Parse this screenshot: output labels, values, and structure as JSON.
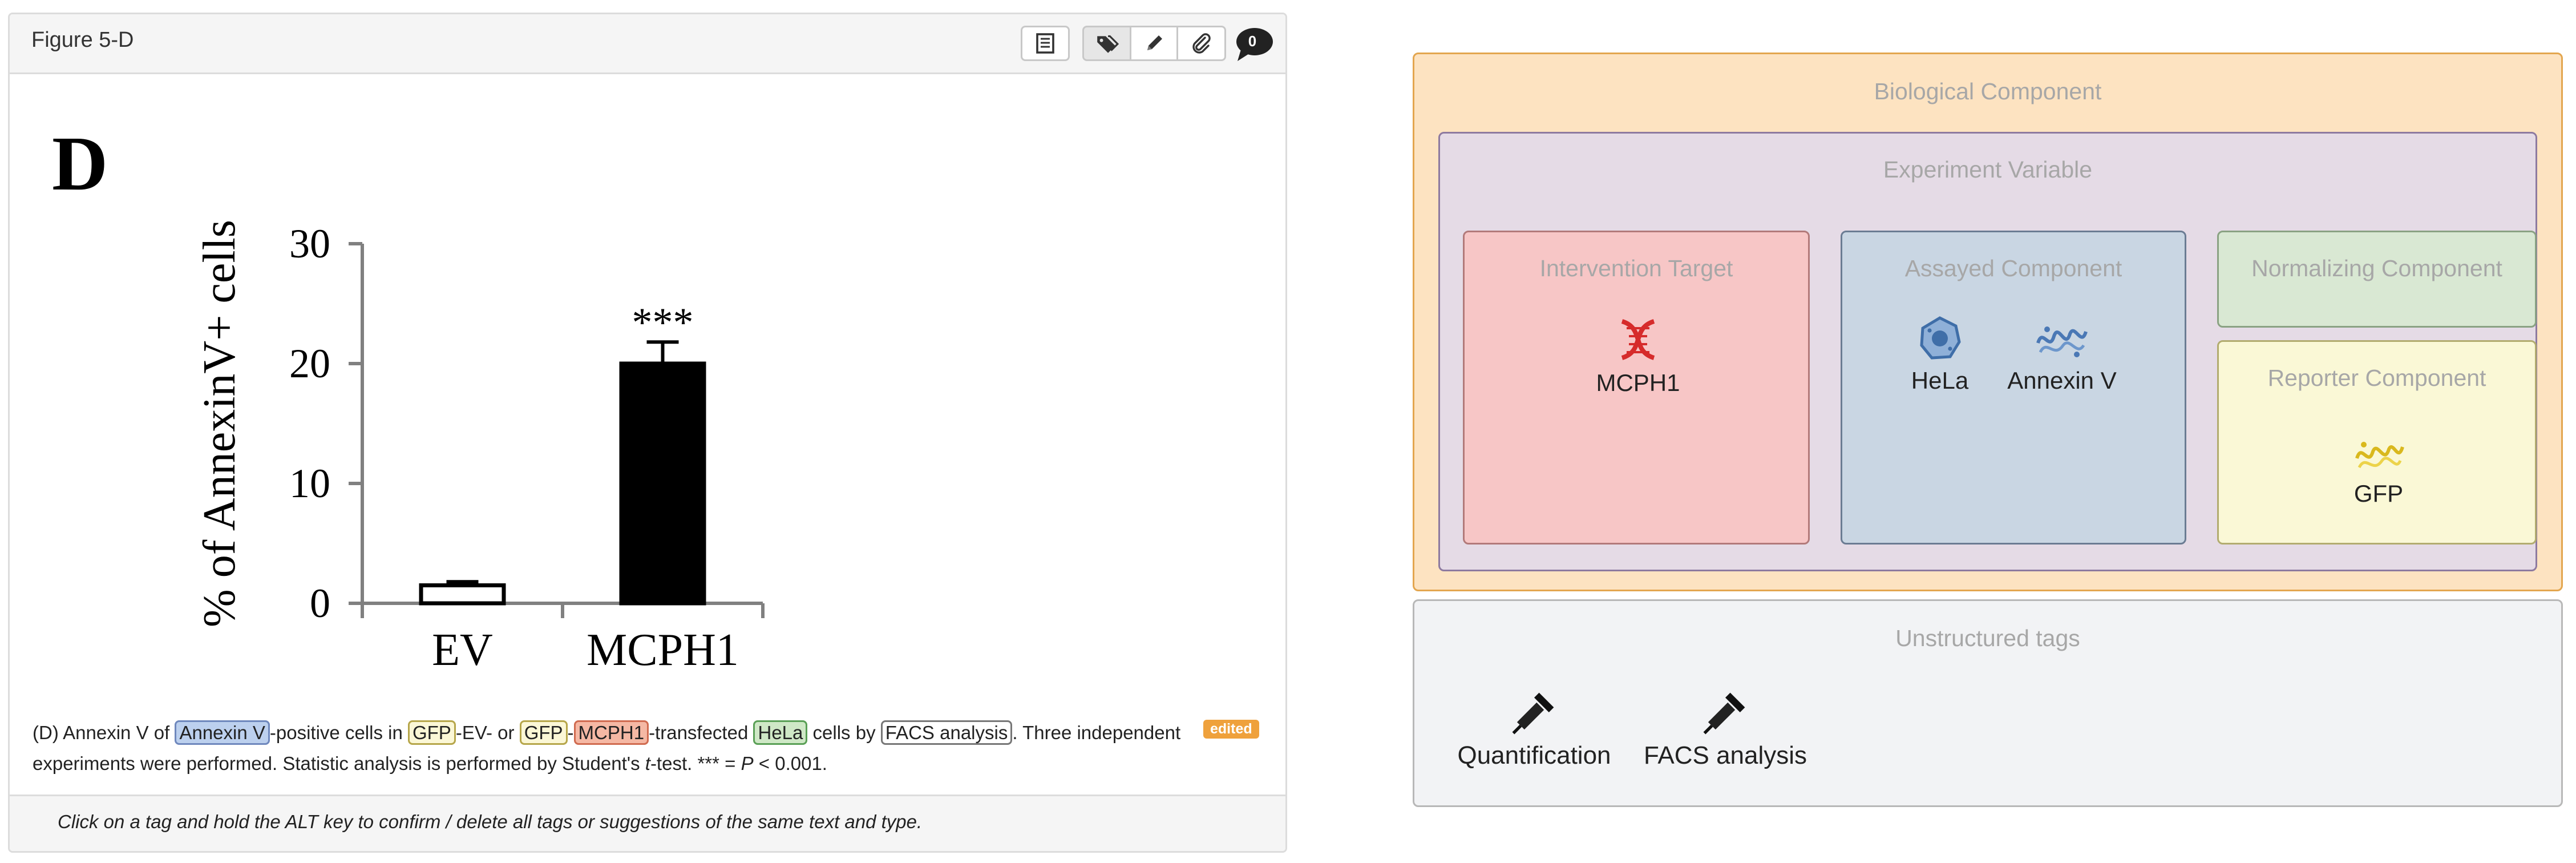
{
  "figure_panel": {
    "title": "Figure 5-D",
    "toolbar": {
      "list_icon": "list-icon",
      "tag_icon": "tags-icon",
      "pencil_icon": "pencil-icon",
      "paperclip_icon": "paperclip-icon",
      "comment_count": "0"
    },
    "figure_letter": "D",
    "chart": {
      "ylabel": "% of AnnexinV+ cells",
      "yticks": [
        "0",
        "10",
        "20",
        "30"
      ],
      "significance": "***"
    },
    "caption": {
      "t1": "(D) Annexin V of ",
      "tag_annexin": "Annexin V",
      "t2": "-positive cells in ",
      "tag_gfp1": "GFP",
      "t3": "-EV- or ",
      "tag_gfp2": "GFP",
      "t4": "-",
      "tag_mcph1": "MCPH1",
      "t5": "-transfected ",
      "tag_hela": "HeLa",
      "t6": " cells by ",
      "tag_facs": "FACS analysis",
      "t7": ". Three independent experiments were performed. Statistic analysis is performed by Student's ",
      "t_italic": "t",
      "t8": "-test. *** = ",
      "p_italic": "P",
      "t9": " < 0.001."
    },
    "edited_badge": "edited",
    "footer_hint": "Click on a tag and hold the ALT key to confirm / delete all tags or suggestions of the same text and type."
  },
  "chart_data": {
    "type": "bar",
    "categories": [
      "EV",
      "MCPH1"
    ],
    "values": [
      1.5,
      20
    ],
    "errors": [
      0.3,
      1.8
    ],
    "bar_fill": [
      "#ffffff",
      "#000000"
    ],
    "ylabel": "% of AnnexinV+ cells",
    "ylim": [
      0,
      30
    ],
    "yticks": [
      0,
      10,
      20,
      30
    ],
    "annotations": [
      {
        "category": "MCPH1",
        "text": "***"
      }
    ]
  },
  "right_panel": {
    "biological_component": "Biological Component",
    "experiment_variable": "Experiment Variable",
    "intervention_target": {
      "label": "Intervention Target",
      "entities": [
        {
          "name": "MCPH1",
          "icon": "dna-icon"
        }
      ]
    },
    "assayed_component": {
      "label": "Assayed Component",
      "entities": [
        {
          "name": "HeLa",
          "icon": "cell-icon"
        },
        {
          "name": "Annexin V",
          "icon": "protein-icon"
        }
      ]
    },
    "normalizing_component": {
      "label": "Normalizing Component"
    },
    "reporter_component": {
      "label": "Reporter Component",
      "entities": [
        {
          "name": "GFP",
          "icon": "protein-icon"
        }
      ]
    },
    "unstructured_tags": {
      "label": "Unstructured tags",
      "items": [
        {
          "name": "Quantification",
          "icon": "pipette-icon"
        },
        {
          "name": "FACS analysis",
          "icon": "pipette-icon"
        }
      ]
    },
    "colors": {
      "biological": "#fde3c1",
      "experiment": "#e5dbe6",
      "intervention": "#f7c6c6",
      "assayed": "#c9d6e3",
      "normalizing": "#d9e8d3",
      "reporter": "#faf8d6",
      "unstructured": "#f2f3f5"
    }
  }
}
